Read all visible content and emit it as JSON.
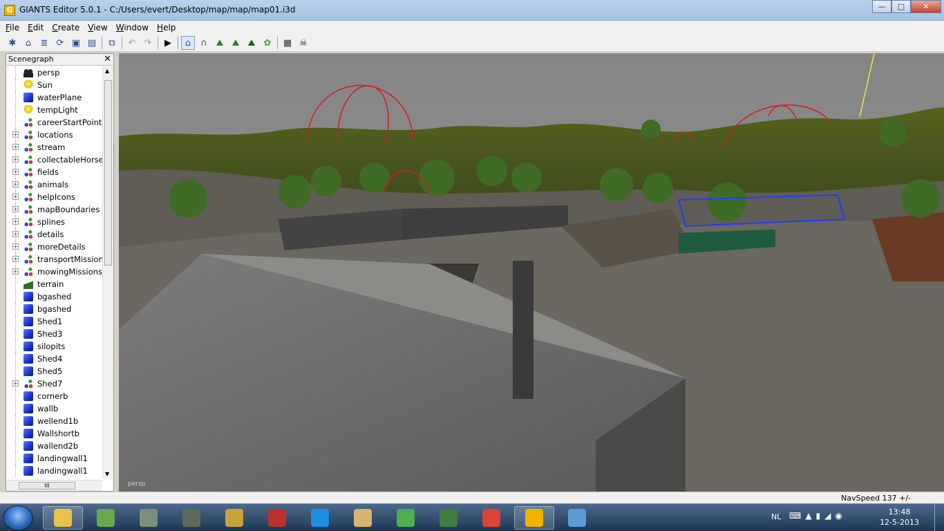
{
  "window": {
    "title": "GIANTS Editor 5.0.1 - C:/Users/evert/Desktop/map/map/map01.i3d",
    "app_icon_glyph": "G",
    "minimize": "—",
    "maximize": "□",
    "close": "✕"
  },
  "menu": [
    "File",
    "Edit",
    "Create",
    "View",
    "Window",
    "Help"
  ],
  "toolbar": {
    "buttons": [
      {
        "icon": "new-icon",
        "glyph": "✱"
      },
      {
        "icon": "open-icon",
        "glyph": "⌂"
      },
      {
        "icon": "document-icon",
        "glyph": "≣"
      },
      {
        "icon": "refresh-icon",
        "glyph": "⟳"
      },
      {
        "icon": "save-icon",
        "glyph": "▣"
      },
      {
        "icon": "save-all-icon",
        "glyph": "▤"
      },
      {
        "icon": "import-icon",
        "glyph": "⧉"
      },
      {
        "icon": "undo-icon",
        "glyph": "↶"
      },
      {
        "icon": "redo-icon",
        "glyph": "↷"
      },
      {
        "icon": "play-icon",
        "glyph": "▶"
      },
      {
        "icon": "select-mode-icon",
        "glyph": "⌂"
      },
      {
        "icon": "magnet-icon",
        "glyph": "∩"
      },
      {
        "icon": "terrain-sculpt-icon",
        "glyph": "⛰"
      },
      {
        "icon": "terrain-paint-icon",
        "glyph": "⛰"
      },
      {
        "icon": "terrain-detail-icon",
        "glyph": "⛰"
      },
      {
        "icon": "foliage-paint-icon",
        "glyph": "✿"
      },
      {
        "icon": "checker-icon",
        "glyph": "▦"
      },
      {
        "icon": "skull-icon",
        "glyph": "☠"
      }
    ]
  },
  "scenegraph": {
    "title": "Scenegraph",
    "close": "✕",
    "hscroll_grip": "III",
    "items": [
      {
        "label": "persp",
        "icon": "camera-icon",
        "expandable": false
      },
      {
        "label": "Sun",
        "icon": "light-icon",
        "expandable": false
      },
      {
        "label": "waterPlane",
        "icon": "shape-icon",
        "expandable": false
      },
      {
        "label": "tempLight",
        "icon": "light-icon",
        "expandable": false
      },
      {
        "label": "careerStartPoint",
        "icon": "transform-group-icon",
        "expandable": false
      },
      {
        "label": "locations",
        "icon": "transform-group-icon",
        "expandable": true
      },
      {
        "label": "stream",
        "icon": "transform-group-icon",
        "expandable": true
      },
      {
        "label": "collectableHorses",
        "icon": "transform-group-icon",
        "expandable": true
      },
      {
        "label": "fields",
        "icon": "transform-group-icon",
        "expandable": true
      },
      {
        "label": "animals",
        "icon": "transform-group-icon",
        "expandable": true
      },
      {
        "label": "helpIcons",
        "icon": "transform-group-icon",
        "expandable": true
      },
      {
        "label": "mapBoundaries",
        "icon": "transform-group-icon",
        "expandable": true
      },
      {
        "label": "splines",
        "icon": "transform-group-icon",
        "expandable": true
      },
      {
        "label": "details",
        "icon": "transform-group-icon",
        "expandable": true
      },
      {
        "label": "moreDetails",
        "icon": "transform-group-icon",
        "expandable": true
      },
      {
        "label": "transportMissions",
        "icon": "transform-group-icon",
        "expandable": true
      },
      {
        "label": "mowingMissions",
        "icon": "transform-group-icon",
        "expandable": true
      },
      {
        "label": "terrain",
        "icon": "terrain-icon",
        "expandable": false
      },
      {
        "label": "bgashed",
        "icon": "shape-icon",
        "expandable": false
      },
      {
        "label": "bgashed",
        "icon": "shape-icon",
        "expandable": false
      },
      {
        "label": "Shed1",
        "icon": "shape-icon",
        "expandable": false
      },
      {
        "label": "Shed3",
        "icon": "shape-icon",
        "expandable": false
      },
      {
        "label": "silopits",
        "icon": "shape-icon",
        "expandable": false
      },
      {
        "label": "Shed4",
        "icon": "shape-icon",
        "expandable": false
      },
      {
        "label": "Shed5",
        "icon": "shape-icon",
        "expandable": false
      },
      {
        "label": "Shed7",
        "icon": "transform-group-icon",
        "expandable": true
      },
      {
        "label": "cornerb",
        "icon": "shape-icon",
        "expandable": false
      },
      {
        "label": "wallb",
        "icon": "shape-icon",
        "expandable": false
      },
      {
        "label": "wellend1b",
        "icon": "shape-icon",
        "expandable": false
      },
      {
        "label": "Wallshortb",
        "icon": "shape-icon",
        "expandable": false
      },
      {
        "label": "wallend2b",
        "icon": "shape-icon",
        "expandable": false
      },
      {
        "label": "landingwall1",
        "icon": "shape-icon",
        "expandable": false
      },
      {
        "label": "landingwall1",
        "icon": "shape-icon",
        "expandable": false
      }
    ]
  },
  "viewport": {
    "camera_label": "persp"
  },
  "statusbar": {
    "nav_speed": "NavSpeed 137 +/-"
  },
  "taskbar": {
    "apps": [
      {
        "name": "explorer",
        "color": "#e8c24a",
        "active": true
      },
      {
        "name": "minecraft",
        "color": "#6aa84f",
        "active": false
      },
      {
        "name": "farming-sim-truck",
        "color": "#7c8f7a",
        "active": false
      },
      {
        "name": "farming-sim-tractor",
        "color": "#5d6b5a",
        "active": false
      },
      {
        "name": "game-shield",
        "color": "#c9a23a",
        "active": false
      },
      {
        "name": "farming-simulator",
        "color": "#b8312f",
        "active": false
      },
      {
        "name": "teamviewer",
        "color": "#1f8fe0",
        "active": false
      },
      {
        "name": "mail",
        "color": "#d7b56d",
        "active": false
      },
      {
        "name": "utorrent",
        "color": "#4caf50",
        "active": false
      },
      {
        "name": "minecraft-block",
        "color": "#3f7f3f",
        "active": false
      },
      {
        "name": "chrome",
        "color": "#db4437",
        "active": false
      },
      {
        "name": "giants-editor",
        "color": "#f0b400",
        "active": true
      },
      {
        "name": "paint",
        "color": "#5b9bd5",
        "active": false
      }
    ],
    "tray": {
      "language": "NL",
      "time": "13:48",
      "date": "12-5-2013"
    }
  }
}
